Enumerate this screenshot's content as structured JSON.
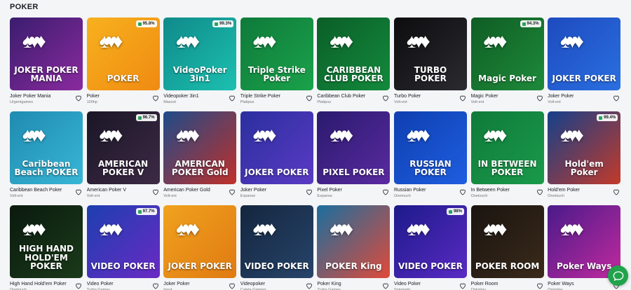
{
  "section": {
    "title": "POKER"
  },
  "games": [
    {
      "name": "Joker Poker Mania",
      "provider": "Urgentgames",
      "art": "JOKER POKER MANIA",
      "bg": "linear-gradient(135deg,#3a1d6e,#8a2a9e)",
      "rtp": ""
    },
    {
      "name": "Poker",
      "provider": "100hp",
      "art": "POKER",
      "bg": "linear-gradient(135deg,#f7b11e,#f08a12)",
      "rtp": "95.8%"
    },
    {
      "name": "Videopoker 3in1",
      "provider": "Mascot",
      "art": "VideoPoker 3in1",
      "bg": "linear-gradient(135deg,#0f8a8a,#1cc0b0)",
      "rtp": "99.3%"
    },
    {
      "name": "Triple Strike Poker",
      "provider": "Platipus",
      "art": "Triple Strike Poker",
      "bg": "linear-gradient(135deg,#0f7a3a,#1aa24b)",
      "rtp": ""
    },
    {
      "name": "Caribbean Club Poker",
      "provider": "Platipus",
      "art": "CARIBBEAN CLUB POKER",
      "bg": "linear-gradient(135deg,#0b5e28,#138a3c)",
      "rtp": ""
    },
    {
      "name": "Turbo Poker",
      "provider": "Volt-ent",
      "art": "TURBO POKER",
      "bg": "linear-gradient(135deg,#0d0d0f,#2a2a30)",
      "rtp": ""
    },
    {
      "name": "Magic Poker",
      "provider": "Volt-ent",
      "art": "Magic Poker",
      "bg": "linear-gradient(135deg,#0f5d24,#1e8a3a)",
      "rtp": "94.3%"
    },
    {
      "name": "Joker Poker",
      "provider": "Volt-ent",
      "art": "JOKER POKER",
      "bg": "linear-gradient(135deg,#1d4bbf,#2a6fe0)",
      "rtp": ""
    },
    {
      "name": "Caribbean Beach Poker",
      "provider": "Volt-ent",
      "art": "Caribbean Beach POKER",
      "bg": "linear-gradient(135deg,#1f8bb0,#38b6d6)",
      "rtp": ""
    },
    {
      "name": "American Poker V",
      "provider": "Volt-ent",
      "art": "AMERICAN POKER V",
      "bg": "linear-gradient(135deg,#1a1626,#3d2a45)",
      "rtp": "96.7%"
    },
    {
      "name": "American Poker Gold",
      "provider": "Volt-ent",
      "art": "AMERICAN POKER Gold",
      "bg": "linear-gradient(135deg,#1e4b8a,#c0302a)",
      "rtp": ""
    },
    {
      "name": "Joker Poker",
      "provider": "Expanse",
      "art": "JOKER POKER",
      "bg": "linear-gradient(135deg,#2b2f9e,#5a3ac4)",
      "rtp": ""
    },
    {
      "name": "Pixel Poker",
      "provider": "Expanse",
      "art": "PIXEL POKER",
      "bg": "linear-gradient(135deg,#2a1a6e,#5a2aa0)",
      "rtp": ""
    },
    {
      "name": "Russian Poker",
      "provider": "Onetouch",
      "art": "RUSSIAN POKER",
      "bg": "linear-gradient(135deg,#0f3fb0,#1e5ee0)",
      "rtp": ""
    },
    {
      "name": "In Between Poker",
      "provider": "Onetouch",
      "art": "IN BETWEEN POKER",
      "bg": "linear-gradient(135deg,#0f7a3a,#1a9a4a)",
      "rtp": ""
    },
    {
      "name": "Hold'em Poker",
      "provider": "Onetouch",
      "art": "Hold'em Poker",
      "bg": "linear-gradient(135deg,#14408a,#c33a2a)",
      "rtp": "99.4%"
    },
    {
      "name": "High Hand Hold'em Poker",
      "provider": "Onetouch",
      "art": "HIGH HAND HOLD'EM POKER",
      "bg": "linear-gradient(135deg,#0a1a0e,#1b3a1a)",
      "rtp": ""
    },
    {
      "name": "Video Poker",
      "provider": "Turbo Games",
      "art": "VIDEO POKER",
      "bg": "linear-gradient(135deg,#1d3fb0,#6a2ac4)",
      "rtp": "97.7%"
    },
    {
      "name": "Joker Poker",
      "provider": "Inout",
      "art": "JOKER POKER",
      "bg": "linear-gradient(135deg,#f0a21e,#e07a12)",
      "rtp": ""
    },
    {
      "name": "Videopoker",
      "provider": "Caleta Gaming",
      "art": "VIDEO POKER",
      "bg": "linear-gradient(135deg,#14263f,#27446a)",
      "rtp": ""
    },
    {
      "name": "Poker King",
      "provider": "Turbo Games",
      "art": "POKER King",
      "bg": "linear-gradient(135deg,#1a6e9e,#e04a3a)",
      "rtp": ""
    },
    {
      "name": "Video Poker",
      "provider": "Spinmatic",
      "art": "VIDEO POKER",
      "bg": "linear-gradient(135deg,#1d1a8a,#5a2ac4)",
      "rtp": "98%"
    },
    {
      "name": "Poker Room",
      "provider": "Onlyplay",
      "art": "POKER ROOM",
      "bg": "linear-gradient(135deg,#1a1410,#3a2a1a)",
      "rtp": ""
    },
    {
      "name": "Poker Ways",
      "provider": "Onlyplay",
      "art": "Poker Ways",
      "bg": "linear-gradient(135deg,#4a1a8a,#c02a9e)",
      "rtp": ""
    }
  ],
  "colors": {
    "accent": "#1fa34b",
    "page_bg": "#f4f5f7"
  },
  "icons": {
    "favorite": "heart-icon",
    "chat": "chat-icon"
  }
}
